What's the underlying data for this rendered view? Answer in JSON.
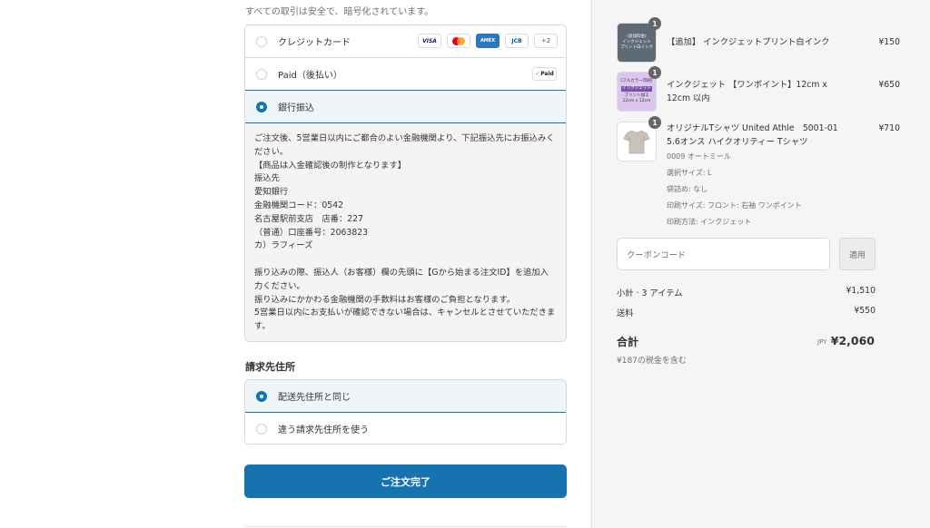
{
  "checkout": {
    "secure_note": "すべての取引は安全で、暗号化されています。",
    "payment_methods": [
      {
        "label": "クレジットカード",
        "selected": false
      },
      {
        "label": "Paid（後払い）",
        "selected": false
      },
      {
        "label": "銀行振込",
        "selected": true
      }
    ],
    "card_brands": [
      "VISA",
      "Mastercard",
      "AMEX",
      "JCB",
      "+2"
    ],
    "paid_logo": "Paid",
    "bank_details": "ご注文後、5営業日以内にご都合のよい金融機関より、下記振込先にお振込みください。\n【商品は入金確認後の制作となります】\n振込先\n愛知銀行\n金融機関コード：0542\n名古屋駅前支店　店番：227\n（普通）口座番号：2063823\nカ）ラフィーズ\n\n振り込みの際、振込人（お客様）欄の先頭に【Gから始まる注文ID】を追加入力ください。\n振り込みにかかわる金融機関の手数料はお客様のご負担となります。\n5営業日以内にお支払いが確認できない場合は、キャンセルとさせていただきます。",
    "billing_title": "請求先住所",
    "billing_options": [
      {
        "label": "配送先住所と同じ",
        "selected": true
      },
      {
        "label": "違う請求先住所を使う",
        "selected": false
      }
    ],
    "complete_button": "ご注文完了"
  },
  "summary": {
    "items": [
      {
        "qty": "1",
        "title": "【追加】 インクジェットプリント白インク",
        "price": "¥150",
        "thumb_text": [
          "(追加料金)",
          "インクジェット",
          "プリント白インク"
        ],
        "meta": []
      },
      {
        "qty": "1",
        "title": "インクジェット 【ワンポイント】12cm x 12cm 以内",
        "price": "¥650",
        "thumb_text": [
          "(フルカラー印刷)",
          "インクジェット",
          "プリント加工",
          "12cm x 12cm"
        ],
        "meta": []
      },
      {
        "qty": "1",
        "title": "オリジナルTシャツ United Athle　5001-01 5.6オンス ハイクオリティー Tシャツ",
        "price": "¥710",
        "meta": [
          "0009 オートミール",
          "選択サイズ: L",
          "袋詰め: なし",
          "印刷サイズ: フロント: 右袖 ワンポイント",
          "印刷方法: インクジェット"
        ]
      }
    ],
    "coupon_placeholder": "クーポンコード",
    "apply_label": "適用",
    "subtotal_label": "小計 · 3 アイテム",
    "subtotal_value": "¥1,510",
    "shipping_label": "送料",
    "shipping_value": "¥550",
    "total_label": "合計",
    "total_currency": "JPY",
    "total_value": "¥2,060",
    "tax_note": "¥187の税金を含む"
  }
}
